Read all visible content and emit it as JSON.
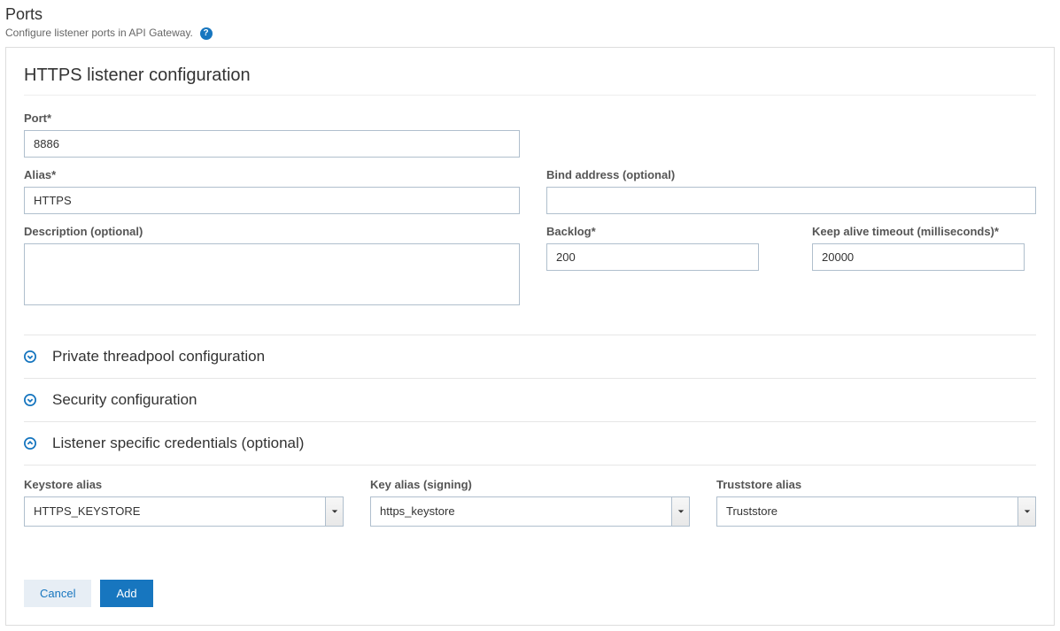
{
  "header": {
    "title": "Ports",
    "subtitle": "Configure listener ports in API Gateway."
  },
  "panel": {
    "title": "HTTPS listener configuration",
    "fields": {
      "port_label": "Port*",
      "port_value": "8886",
      "alias_label": "Alias*",
      "alias_value": "HTTPS",
      "description_label": "Description (optional)",
      "description_value": "",
      "bind_label": "Bind address (optional)",
      "bind_value": "",
      "backlog_label": "Backlog*",
      "backlog_value": "200",
      "keepalive_label": "Keep alive timeout (milliseconds)*",
      "keepalive_value": "20000"
    },
    "sections": {
      "threadpool": "Private threadpool configuration",
      "security": "Security configuration",
      "credentials": "Listener specific credentials (optional)"
    },
    "credentials": {
      "keystore_label": "Keystore alias",
      "keystore_value": "HTTPS_KEYSTORE",
      "keyalias_label": "Key alias (signing)",
      "keyalias_value": "https_keystore",
      "truststore_label": "Truststore alias",
      "truststore_value": "Truststore"
    },
    "buttons": {
      "cancel": "Cancel",
      "add": "Add"
    }
  }
}
